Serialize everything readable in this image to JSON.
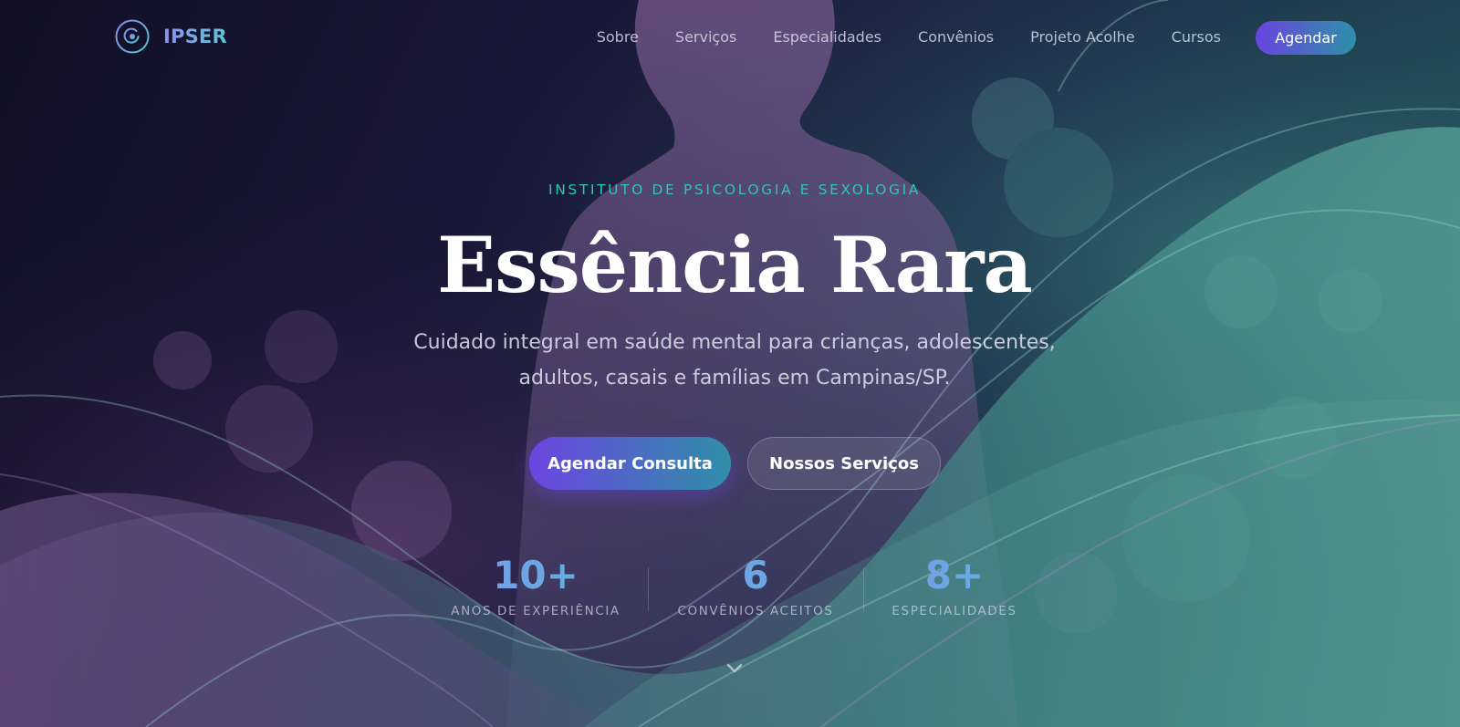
{
  "brand": {
    "name": "IPSER",
    "logo_icon": "target-circle-icon"
  },
  "nav": {
    "links": [
      "Sobre",
      "Serviços",
      "Especialidades",
      "Convênios",
      "Projeto Acolhe",
      "Cursos"
    ],
    "cta_label": "Agendar"
  },
  "hero": {
    "eyebrow": "INSTITUTO DE PSICOLOGIA E SEXOLOGIA",
    "title": "Essência Rara",
    "subtitle": "Cuidado integral em saúde mental para crianças, adolescentes, adultos, casais e famílias em Campinas/SP.",
    "primary_button": "Agendar Consulta",
    "secondary_button": "Nossos Serviços",
    "scroll_icon": "chevron-down-icon"
  },
  "stats": [
    {
      "value": "10+",
      "label": "ANOS DE EXPERIÊNCIA"
    },
    {
      "value": "6",
      "label": "CONVÊNIOS ACEITOS"
    },
    {
      "value": "8+",
      "label": "ESPECIALIDADES"
    }
  ],
  "colors": {
    "accent_teal": "#2ec4bc",
    "accent_purple": "#6c45e2",
    "background": "#14122b"
  }
}
